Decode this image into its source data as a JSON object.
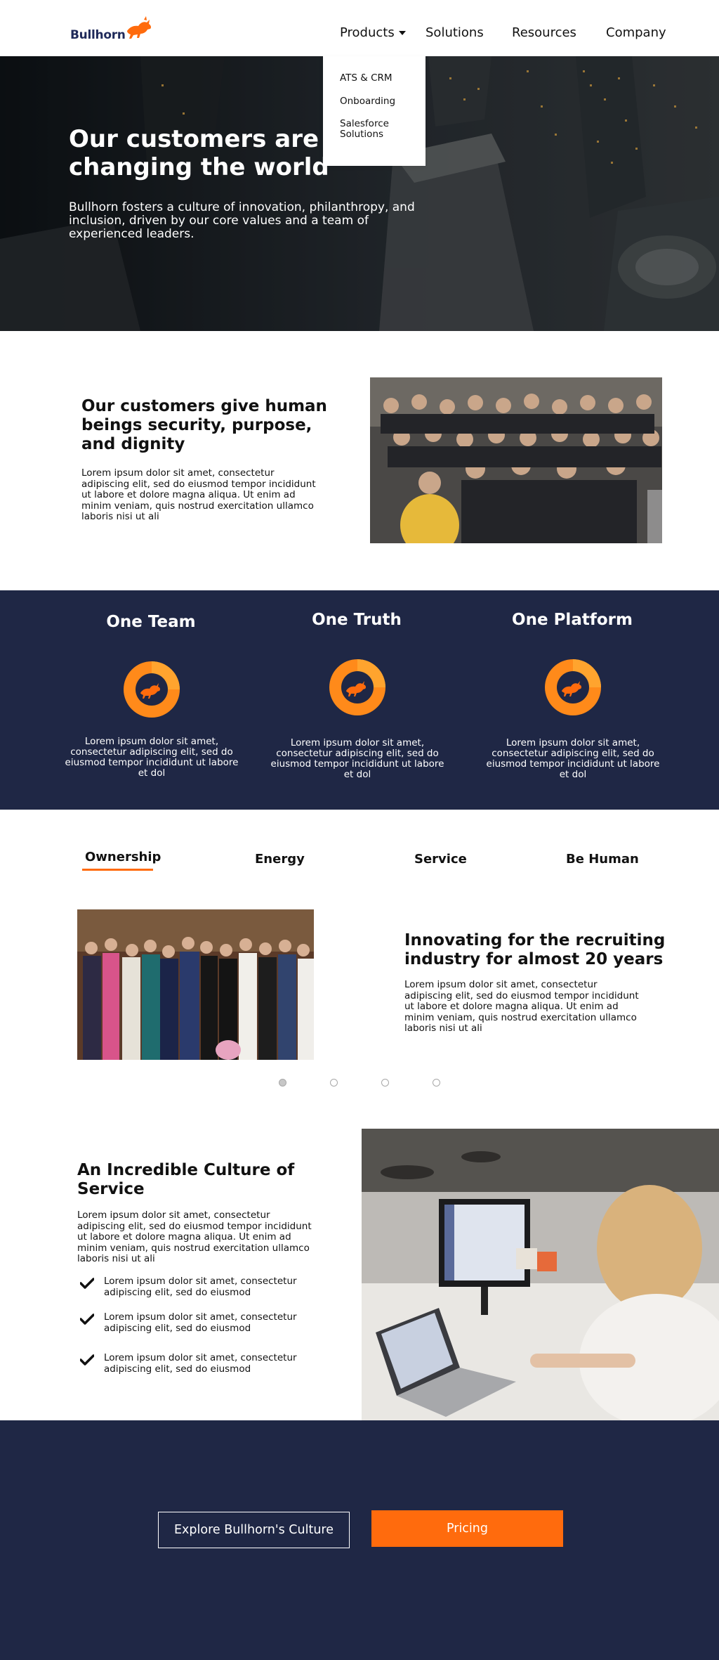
{
  "nav": {
    "logo_text": "Bullhorn",
    "items": [
      {
        "label": "Products"
      },
      {
        "label": "Solutions"
      },
      {
        "label": "Resources"
      },
      {
        "label": "Company"
      }
    ],
    "dropdown": [
      "ATS & CRM",
      "Onboarding",
      "Salesforce Solutions"
    ]
  },
  "hero": {
    "title": "Our customers are changing the world",
    "subtitle": "Bullhorn fosters a culture of innovation, philanthropy, and inclusion, driven by our core values and a team of experienced leaders."
  },
  "human": {
    "title": "Our customers give human beings security, purpose, and dignity",
    "text": "Lorem ipsum dolor sit amet, consectetur adipiscing elit, sed do eiusmod tempor incididunt ut labore et dolore magna aliqua. Ut enim ad minim veniam, quis nostrud exercitation ullamco laboris nisi ut ali"
  },
  "values": [
    {
      "title": "One Team",
      "text": "Lorem ipsum dolor sit amet, consectetur adipiscing elit, sed do eiusmod tempor incididunt ut labore et dol",
      "icon": "bull-logo-icon"
    },
    {
      "title": "One Truth",
      "text": "Lorem ipsum dolor sit amet, consectetur adipiscing elit, sed do eiusmod tempor incididunt ut labore et dol",
      "icon": "bull-logo-icon"
    },
    {
      "title": "One Platform",
      "text": "Lorem ipsum dolor sit amet, consectetur adipiscing elit, sed do eiusmod tempor incididunt ut labore et dol",
      "icon": "bull-logo-icon"
    }
  ],
  "tabs": [
    "Ownership",
    "Energy",
    "Service",
    "Be Human"
  ],
  "innovating": {
    "title": "Innovating for the recruiting industry for almost 20 years",
    "text": "Lorem ipsum dolor sit amet, consectetur adipiscing elit, sed do eiusmod tempor incididunt ut labore et dolore magna aliqua. Ut enim ad minim veniam, quis nostrud exercitation ullamco laboris nisi ut ali"
  },
  "carousel": {
    "count": 4,
    "active": 1
  },
  "culture": {
    "title": "An Incredible Culture of Service",
    "text": "Lorem ipsum dolor sit amet, consectetur adipiscing elit, sed do eiusmod tempor incididunt ut labore et dolore magna aliqua. Ut enim ad minim veniam, quis nostrud exercitation ullamco laboris nisi ut ali",
    "checks": [
      "Lorem ipsum dolor sit amet, consectetur adipiscing elit, sed do eiusmod",
      "Lorem ipsum dolor sit amet, consectetur adipiscing elit, sed do eiusmod",
      "Lorem ipsum dolor sit amet, consectetur adipiscing elit, sed do eiusmod"
    ]
  },
  "cta": {
    "explore_label": "Explore Bullhorn's Culture",
    "pricing_label": "Pricing"
  },
  "colors": {
    "navy": "#1f2745",
    "orange": "#ff6b0d",
    "logo_blue": "#1f2a5a"
  }
}
